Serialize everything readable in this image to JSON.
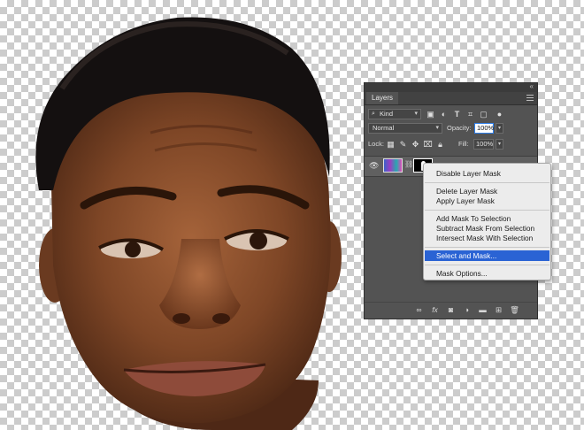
{
  "panel": {
    "tab_label": "Layers",
    "filter_label": "Kind",
    "blend_mode": "Normal",
    "opacity_label": "Opacity:",
    "opacity_value": "100%",
    "lock_label": "Lock:",
    "fill_label": "Fill:",
    "fill_value": "100%"
  },
  "context_menu": {
    "items": [
      "Disable Layer Mask",
      "Delete Layer Mask",
      "Apply Layer Mask",
      "Add Mask To Selection",
      "Subtract Mask From Selection",
      "Intersect Mask With Selection",
      "Select and Mask...",
      "Mask Options..."
    ],
    "highlighted_item": "Select and Mask...",
    "highlight_color": "#2a63d4"
  },
  "icons": {
    "kind_search": "magnifier",
    "filter_pixel": "image-icon",
    "filter_adjustment": "half-circle-icon",
    "filter_type": "T",
    "filter_shape": "shape-icon",
    "filter_smart": "smart-object-icon",
    "filter_toggle": "toggle-dot",
    "lock_transparent": "checker-icon",
    "lock_pixels": "brush-icon",
    "lock_position": "move-icon",
    "lock_artboard": "artboard-icon",
    "lock_all": "padlock-icon",
    "visibility": "eye-icon",
    "link": "chain-icon",
    "footer": [
      "link-layers",
      "fx",
      "add-mask",
      "adjustment",
      "group-folder",
      "new-layer",
      "trash"
    ]
  }
}
